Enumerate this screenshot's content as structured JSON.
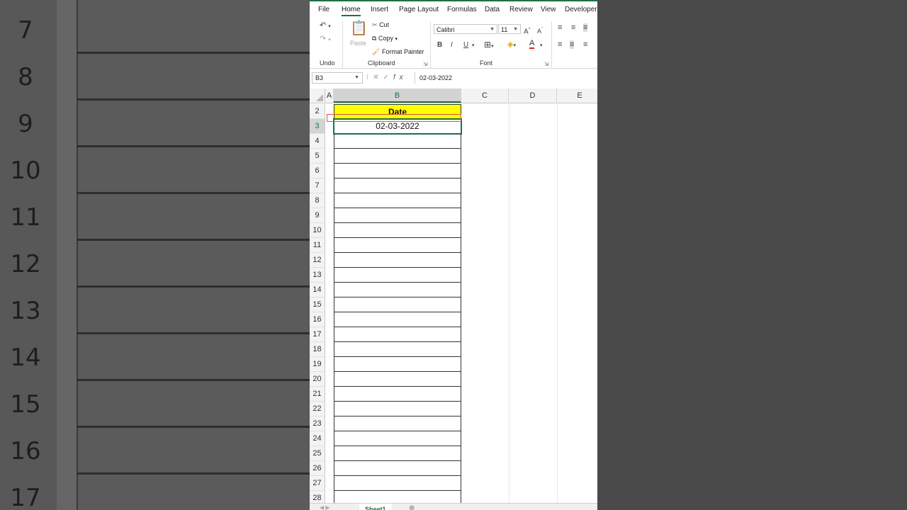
{
  "background": {
    "row_numbers": [
      "7",
      "8",
      "9",
      "10",
      "11",
      "12",
      "13",
      "14",
      "15",
      "16",
      "17"
    ]
  },
  "menu_tabs": [
    "File",
    "Home",
    "Insert",
    "Page Layout",
    "Formulas",
    "Data",
    "Review",
    "View",
    "Developer"
  ],
  "active_tab": "Home",
  "ribbon": {
    "undo_group": "Undo",
    "clipboard_group": "Clipboard",
    "font_group": "Font",
    "paste_label": "Paste",
    "cut_label": "Cut",
    "copy_label": "Copy",
    "format_painter_label": "Format Painter",
    "font_name": "Calibri",
    "font_size": "11",
    "bold": "B",
    "italic": "I",
    "underline": "U"
  },
  "formula_bar": {
    "name_box": "B3",
    "fx": "fx",
    "value": "02-03-2022"
  },
  "columns": [
    "A",
    "B",
    "C",
    "D",
    "E"
  ],
  "selected_column": "B",
  "rows": [
    "2",
    "3",
    "4",
    "5",
    "6",
    "7",
    "8",
    "9",
    "10",
    "11",
    "12",
    "13",
    "14",
    "15",
    "16",
    "17",
    "18",
    "19",
    "20",
    "21",
    "22",
    "23",
    "24",
    "25",
    "26",
    "27",
    "28"
  ],
  "selected_row": "3",
  "cells": {
    "b2": "Date",
    "b3": "02-03-2022"
  },
  "sheet_tab": "Sheet1",
  "colors": {
    "accent": "#1e7145",
    "header_fill": "#ffff00",
    "annotation": "#e05050"
  }
}
